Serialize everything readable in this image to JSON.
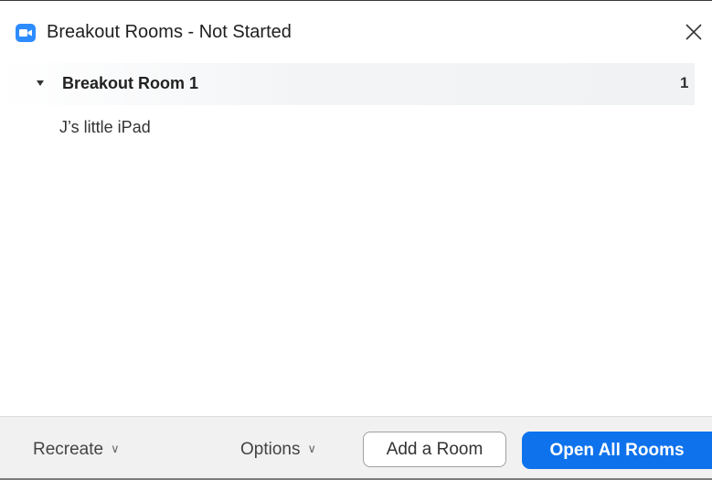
{
  "window": {
    "title": "Breakout Rooms - Not Started",
    "app_icon": "zoom-camera-icon",
    "close_glyph": "×"
  },
  "rooms": [
    {
      "name": "Breakout Room 1",
      "count": "1",
      "expanded": true,
      "participants": [
        "J’s little iPad"
      ]
    }
  ],
  "footer": {
    "recreate_label": "Recreate",
    "options_label": "Options",
    "chevron_glyph": "∨",
    "add_room_label": "Add a Room",
    "open_all_label": "Open All Rooms"
  },
  "colors": {
    "accent": "#0e72ed",
    "app_icon": "#2d8cff",
    "footer_bg": "#f1f1f1",
    "room_header_bg": "#f0f2f4"
  }
}
